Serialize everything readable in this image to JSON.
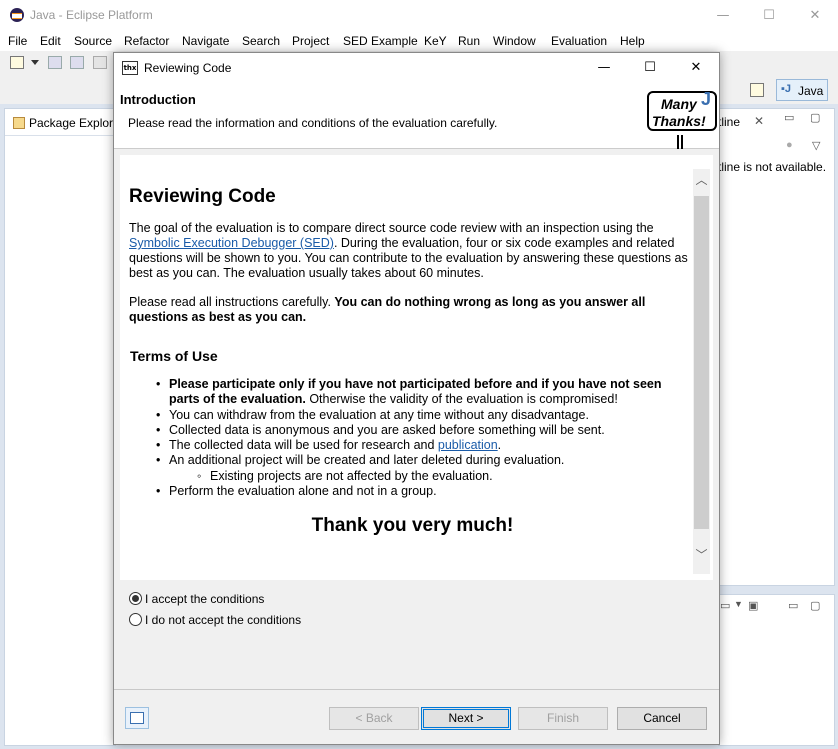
{
  "main_window": {
    "title": "Java - Eclipse Platform",
    "controls": {
      "minimize": "—",
      "maximize": "☐",
      "close": "✕"
    },
    "menu": [
      "File",
      "Edit",
      "Source",
      "Refactor",
      "Navigate",
      "Search",
      "Project",
      "SED Example",
      "KeY",
      "Run",
      "Window",
      "Evaluation",
      "Help"
    ],
    "perspective": {
      "label": "Java"
    },
    "left_view": {
      "tab_label": "Package Explore"
    },
    "right_view": {
      "tab_label": "tline",
      "close": "✕",
      "message": "tline is not available."
    }
  },
  "dialog": {
    "title": "Reviewing Code",
    "icon_text": "thx",
    "controls": {
      "minimize": "—",
      "maximize": "☐",
      "close": "✕"
    },
    "banner": {
      "heading": "Introduction",
      "description": "Please read the information and conditions of the evaluation carefully.",
      "sign_line1": "Many",
      "sign_line2": "Thanks!",
      "sign_j": "J"
    },
    "content": {
      "title": "Reviewing Code",
      "intro_before_link": "The goal of the evaluation is to compare direct source code review with an inspection using the ",
      "intro_link": "Symbolic Execution Debugger (SED)",
      "intro_after_link": ". During the evaluation, four or six code examples and related questions will be shown to you. You can contribute to the evaluation by answering these questions as best as you can. The evaluation usually takes about 60 minutes.",
      "instructions_plain": "Please read all instructions carefully. ",
      "instructions_bold": "You can do nothing wrong as long as you answer all questions as best as you can.",
      "terms_heading": "Terms of Use",
      "terms": {
        "t1_bold": "Please participate only if you have not participated before and if you have not seen parts of the evaluation.",
        "t1_plain": " Otherwise the validity of the evaluation is compromised!",
        "t2": "You can withdraw from the evaluation at any time without any disadvantage.",
        "t3": "Collected data is anonymous and you are asked before something will be sent.",
        "t4_plain": "The collected data will be used for research and ",
        "t4_link": "publication",
        "t4_end": ".",
        "t5": "An additional project will be created and later deleted during evaluation.",
        "t5_sub": "Existing projects are not affected by the evaluation.",
        "t6": "Perform the evaluation alone and not in a group."
      },
      "closing": "Thank you very much!"
    },
    "scroll": {
      "up": "︿",
      "down": "﹀",
      "position": 0
    },
    "options": {
      "accept": "I accept the conditions",
      "decline": "I do not accept the conditions",
      "selected": "accept"
    },
    "buttons": {
      "back": "< Back",
      "next": "Next >",
      "finish": "Finish",
      "cancel": "Cancel"
    }
  }
}
